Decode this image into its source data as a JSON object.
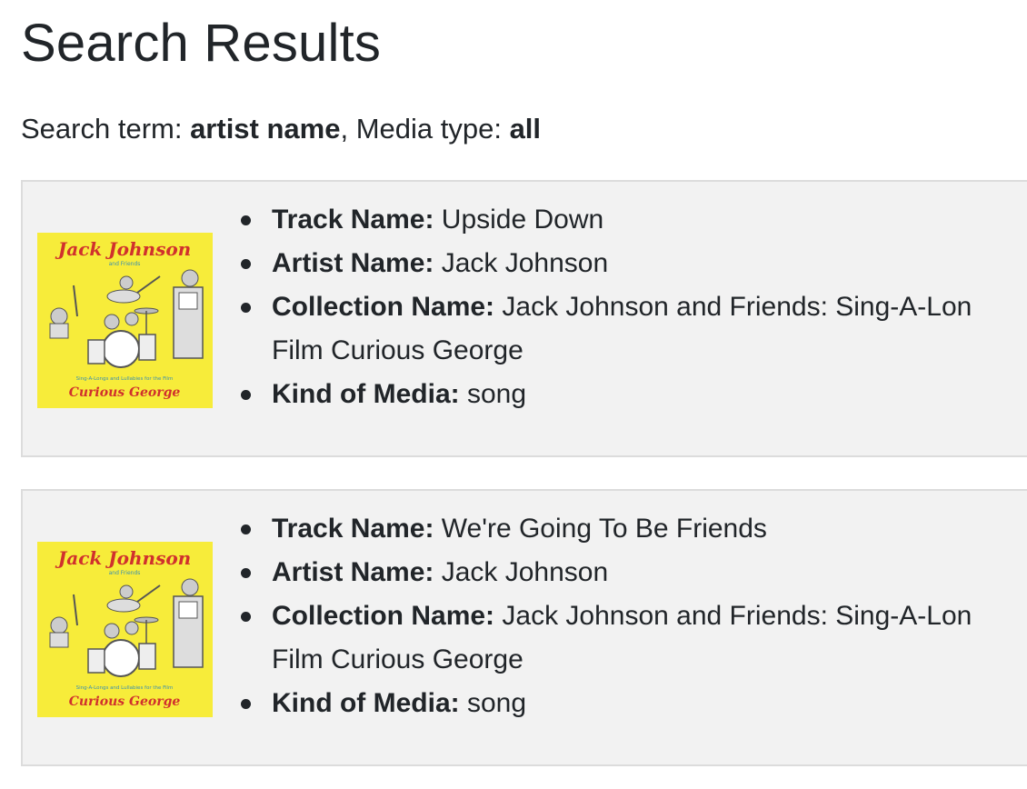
{
  "page": {
    "title": "Search Results",
    "summary": {
      "term_label": "Search term: ",
      "term_value": "artist name",
      "sep": ", Media type: ",
      "media_value": "all"
    }
  },
  "labels": {
    "track": "Track Name:",
    "artist": "Artist Name:",
    "collection": "Collection Name:",
    "kind": "Kind of Media:"
  },
  "album_art": {
    "title_text": "Jack Johnson",
    "subtitle_text": "and Friends",
    "footer_small": "Sing-A-Longs and Lullabies for the Film",
    "footer_big": "Curious George",
    "background": "#f7ec3a",
    "title_color": "#d0312d"
  },
  "results": [
    {
      "track": "Upside Down",
      "artist": "Jack Johnson",
      "collection_line1": "Jack Johnson and Friends: Sing-A-Lon",
      "collection_line2": "Film Curious George",
      "kind": "song"
    },
    {
      "track": "We're Going To Be Friends",
      "artist": "Jack Johnson",
      "collection_line1": "Jack Johnson and Friends: Sing-A-Lon",
      "collection_line2": "Film Curious George",
      "kind": "song"
    }
  ]
}
